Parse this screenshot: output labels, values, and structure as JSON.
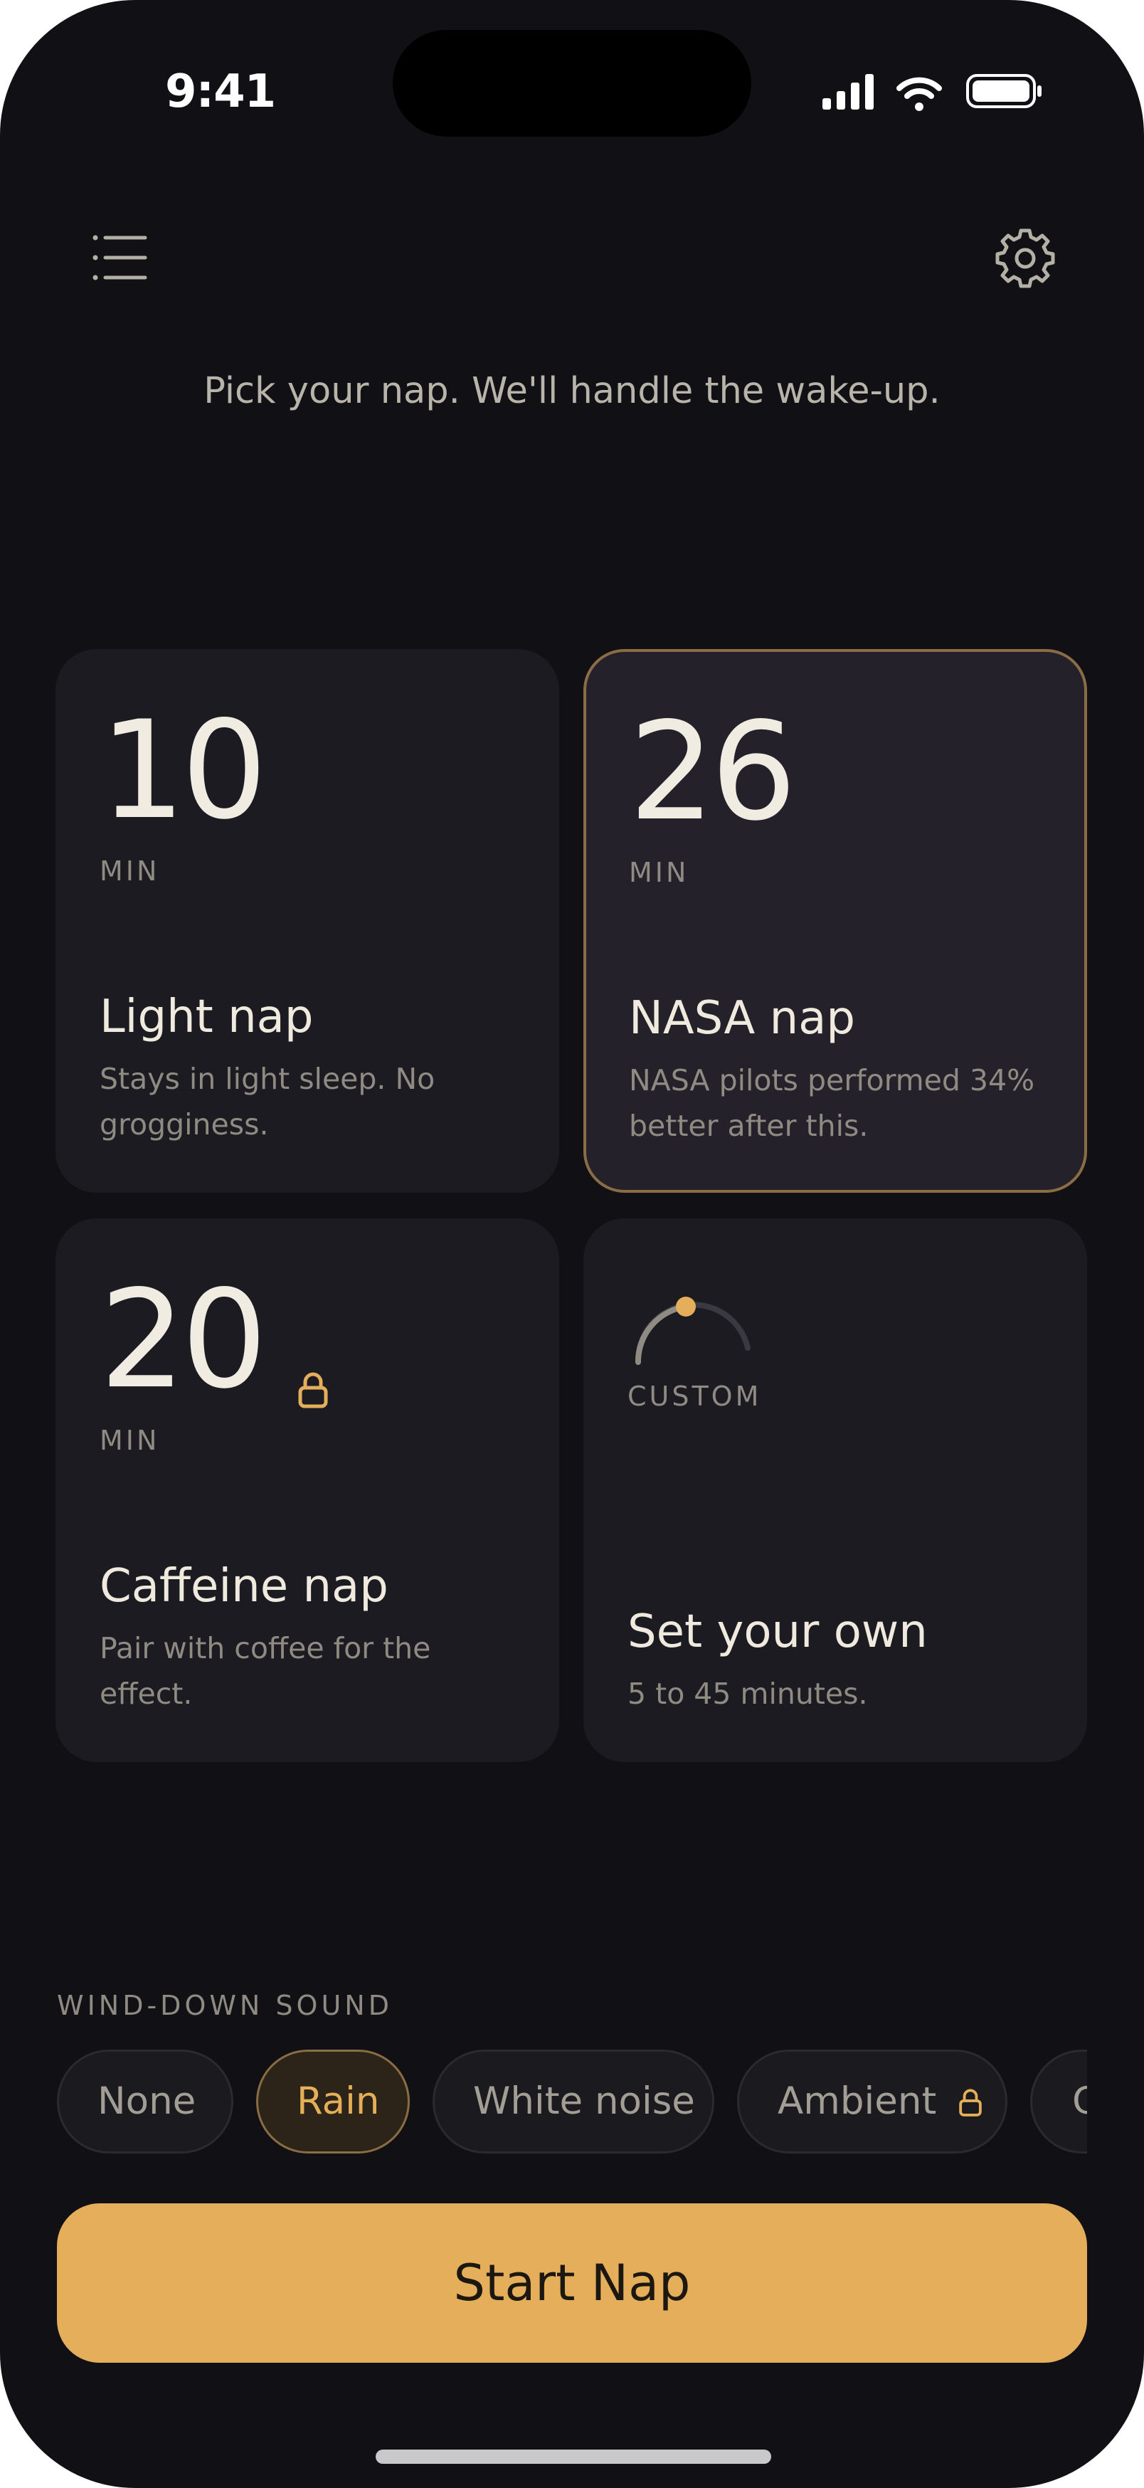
{
  "status_bar": {
    "time": "9:41"
  },
  "header": {
    "menu_icon": "list-icon",
    "settings_icon": "gear-icon",
    "tagline": "Pick your nap. We'll handle the wake-up."
  },
  "presets": [
    {
      "minutes": "10",
      "unit": "MIN",
      "title": "Light nap",
      "desc": "Stays in light sleep. No grogginess.",
      "selected": false,
      "locked": false
    },
    {
      "minutes": "26",
      "unit": "MIN",
      "title": "NASA nap",
      "desc": "NASA pilots performed 34% better after this.",
      "selected": true,
      "locked": false
    },
    {
      "minutes": "20",
      "unit": "MIN",
      "title": "Caffeine nap",
      "desc": "Pair with coffee for the effect.",
      "selected": false,
      "locked": true
    },
    {
      "label": "CUSTOM",
      "title": "Set your own",
      "desc": "5 to 45 minutes.",
      "selected": false,
      "locked": false
    }
  ],
  "sounds": {
    "label": "WIND-DOWN SOUND",
    "options": [
      {
        "name": "None",
        "active": false,
        "locked": false
      },
      {
        "name": "Rain",
        "active": true,
        "locked": false
      },
      {
        "name": "White noise",
        "active": false,
        "locked": false
      },
      {
        "name": "Ambient",
        "active": false,
        "locked": true
      },
      {
        "name": "C",
        "active": false,
        "locked": false
      }
    ]
  },
  "cta": {
    "label": "Start Nap"
  },
  "colors": {
    "background": "#111115",
    "card": "#1c1b22",
    "accent": "#e4ae5a",
    "selected_border": "#8a6d44"
  }
}
